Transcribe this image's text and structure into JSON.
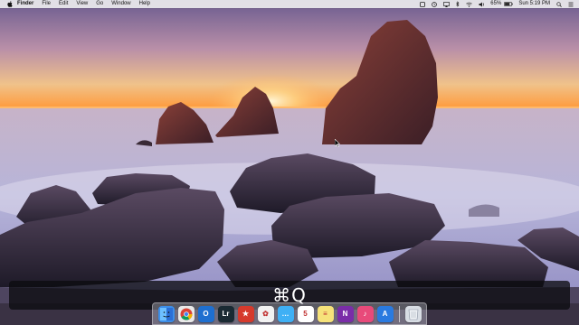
{
  "menubar": {
    "app_name": "Finder",
    "menus": [
      "File",
      "Edit",
      "View",
      "Go",
      "Window",
      "Help"
    ],
    "battery": "65%",
    "clock": "Sun 5:19 PM"
  },
  "overlay": {
    "shortcut": "⌘Q"
  },
  "dock": {
    "apps": [
      {
        "icon": "finder-icon",
        "color": "#3d8ee8",
        "glyph": ""
      },
      {
        "icon": "chrome-icon",
        "color": "#e9e9e9",
        "glyph": ""
      },
      {
        "icon": "outlook-icon",
        "color": "#1e6fd0",
        "glyph": "O"
      },
      {
        "icon": "lightroom-icon",
        "color": "#1a2a33",
        "glyph": "Lr"
      },
      {
        "icon": "flashcard-icon",
        "color": "#d63a2c",
        "glyph": "★"
      },
      {
        "icon": "photos-icon",
        "color": "#f2f2f2",
        "glyph": "✿"
      },
      {
        "icon": "messages-icon",
        "color": "#3fb0f5",
        "glyph": "…"
      },
      {
        "icon": "calendar-icon",
        "color": "#ffffff",
        "glyph": "5"
      },
      {
        "icon": "notes-icon",
        "color": "#f6e27a",
        "glyph": "≡"
      },
      {
        "icon": "onenote-icon",
        "color": "#7a2da8",
        "glyph": "N"
      },
      {
        "icon": "itunes-icon",
        "color": "#e84a7a",
        "glyph": "♪"
      },
      {
        "icon": "appstore-icon",
        "color": "#2a7ae0",
        "glyph": "A"
      },
      {
        "icon": "trash-icon",
        "color": "#d8dde4",
        "glyph": ""
      }
    ]
  }
}
